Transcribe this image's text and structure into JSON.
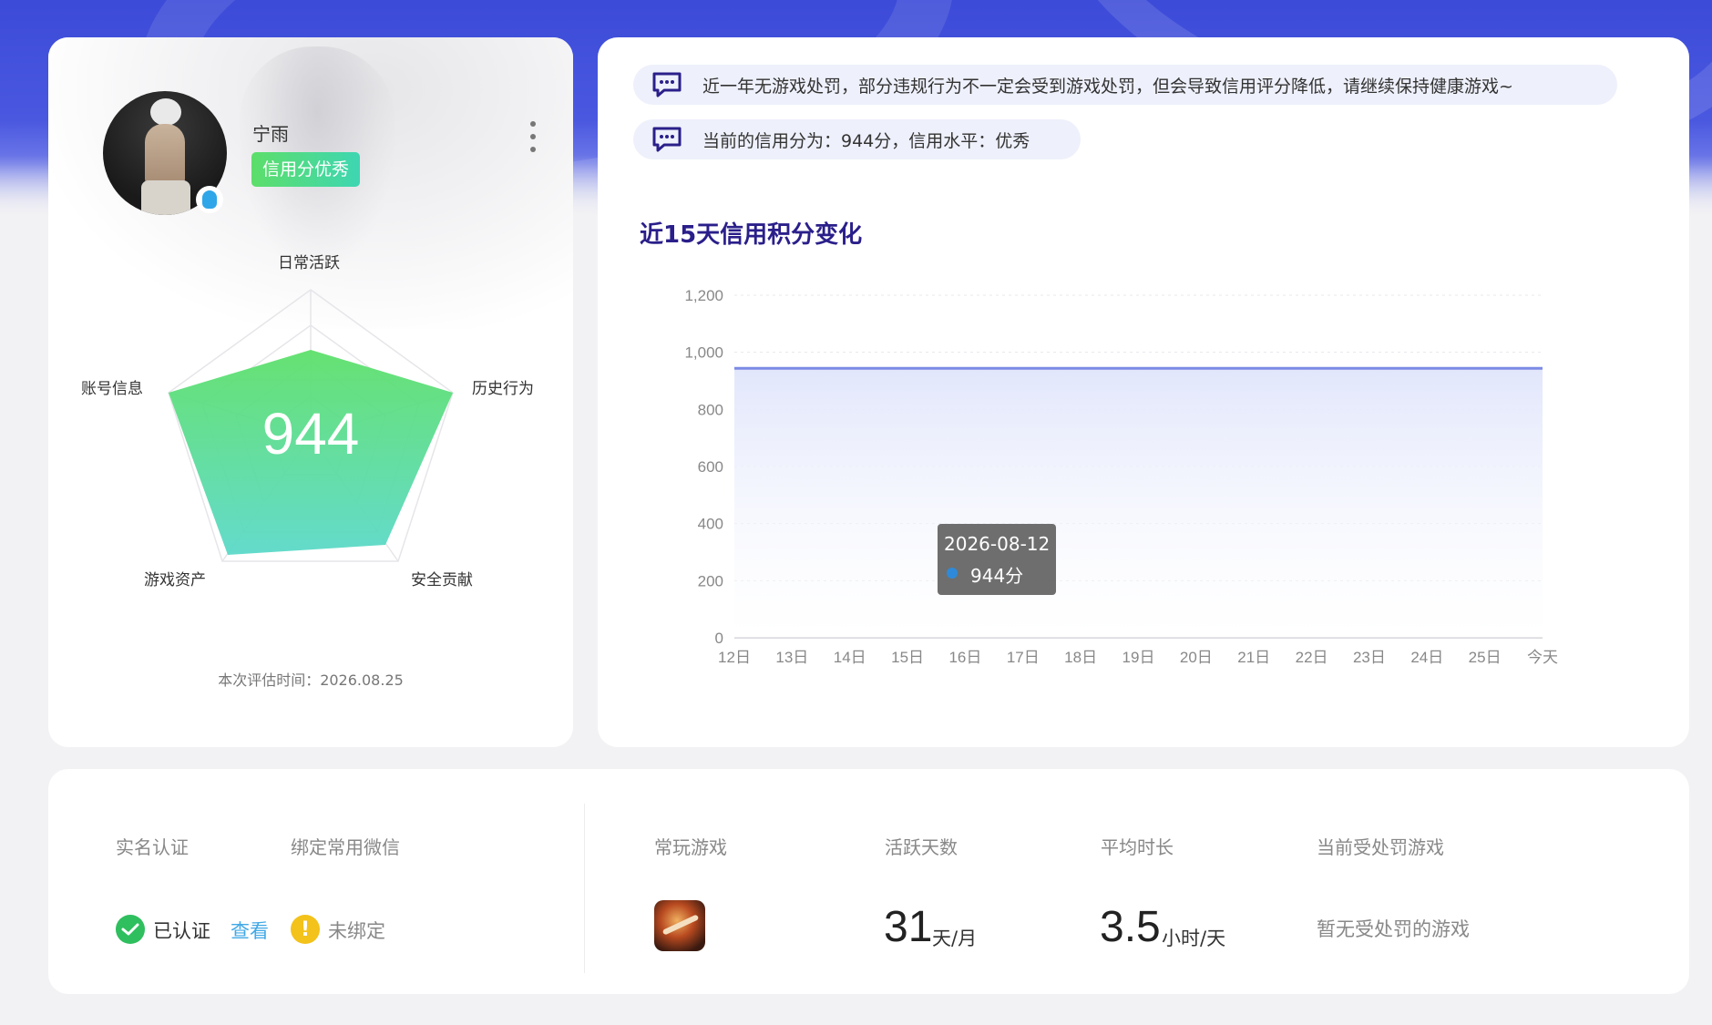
{
  "profile": {
    "username": "宁雨",
    "credit_badge": "信用分优秀",
    "score": "944",
    "radar_labels": {
      "top": "日常活跃",
      "right": "历史行为",
      "bottom_right": "安全贡献",
      "bottom_left": "游戏资产",
      "left": "账号信息"
    },
    "eval_time": "本次评估时间：2026.08.25"
  },
  "notices": [
    "近一年无游戏处罚，部分违规行为不一定会受到游戏处罚，但会导致信用评分降低，请继续保持健康游戏~",
    "当前的信用分为：944分，信用水平：优秀"
  ],
  "chart_data": {
    "type": "area",
    "title": "近15天信用积分变化",
    "categories": [
      "12日",
      "13日",
      "14日",
      "15日",
      "16日",
      "17日",
      "18日",
      "19日",
      "20日",
      "21日",
      "22日",
      "23日",
      "24日",
      "25日",
      "今天"
    ],
    "values": [
      944,
      944,
      944,
      944,
      944,
      944,
      944,
      944,
      944,
      944,
      944,
      944,
      944,
      944,
      944
    ],
    "y_ticks": [
      "0",
      "200",
      "400",
      "600",
      "800",
      "1,000",
      "1,200"
    ],
    "ylim": [
      0,
      1200
    ],
    "grid": true,
    "tooltip": {
      "date": "2026-08-12",
      "value": "944分"
    },
    "colors": {
      "line": "#7c8ae6",
      "fill": "#e6e9fb"
    }
  },
  "stats": {
    "realname_label": "实名认证",
    "wechat_label": "绑定常用微信",
    "realname_status": "已认证",
    "view_link": "查看",
    "wechat_status": "未绑定",
    "games_label": "常玩游戏",
    "active_days_label": "活跃天数",
    "active_days_value": "31",
    "active_days_unit": "天/月",
    "avg_time_label": "平均时长",
    "avg_time_value": "3.5",
    "avg_time_unit": "小时/天",
    "punished_label": "当前受处罚游戏",
    "punished_value": "暂无受处罚的游戏"
  },
  "colors": {
    "accent": "#3c4bd8",
    "badge_start": "#5dde6a",
    "badge_end": "#3ed6b2",
    "link": "#41a8e6",
    "ok": "#2fbf5e",
    "warn": "#f3c21b"
  }
}
